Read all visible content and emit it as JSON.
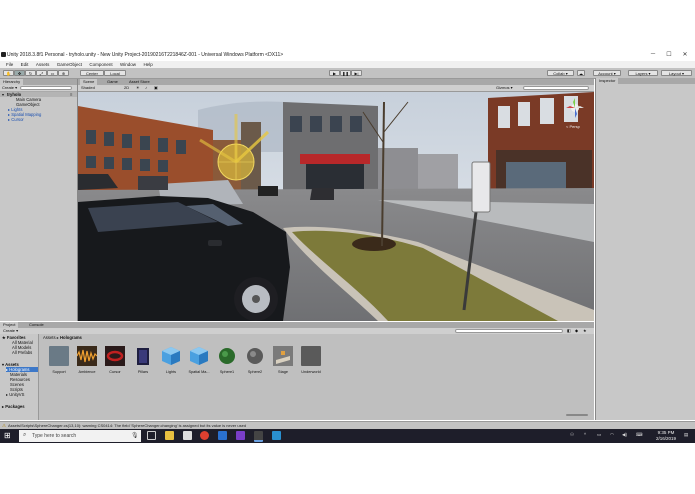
{
  "window": {
    "title": "Unity 2018.3.8f1 Personal - tryholo.unity - New Unity Project-20190216T221846Z-001 - Universal Windows Platform <DX11>",
    "controls": [
      "─",
      "☐",
      "✕"
    ]
  },
  "menu": [
    "File",
    "Edit",
    "Assets",
    "GameObject",
    "Component",
    "Window",
    "Help"
  ],
  "toolbar": {
    "pivot_label": "Center",
    "space_label": "Local",
    "collab_label": "Collab ▾",
    "account_label": "Account ▾",
    "layers_label": "Layers ▾",
    "layout_label": "Layout ▾"
  },
  "hierarchy": {
    "tab": "Hierarchy",
    "create_label": "Create ▾",
    "scene_name": "tryholo",
    "items": [
      "Main Camera",
      "GameObject",
      "Lights",
      "Spatial Mapping",
      "Cursor"
    ]
  },
  "scene_view": {
    "tabs": [
      "Scene",
      "Game",
      "Asset Store"
    ],
    "shading": "Shaded",
    "mode_2d": "2D",
    "gizmos": "Gizmos ▾",
    "persp": "< Persp"
  },
  "project": {
    "tabs": [
      "Project",
      "Console"
    ],
    "create_label": "Create ▾",
    "breadcrumb": [
      "Assets",
      "Holograms"
    ],
    "favorites_title": "Favorites",
    "favorites": [
      "All Material",
      "All Models",
      "All Prefabs"
    ],
    "assets_title": "Assets",
    "folders": [
      "Holograms",
      "Materials",
      "Resources",
      "Scenes",
      "Scripts",
      "UnityVS"
    ],
    "packages_title": "Packages",
    "assets": [
      {
        "label": "Support",
        "color": "#6a7a86"
      },
      {
        "label": "Ambience",
        "color": "#d07a20"
      },
      {
        "label": "Cursor",
        "color": "#8a1a1a"
      },
      {
        "label": "Pillars",
        "color": "#2a2a5a"
      },
      {
        "label": "Lights",
        "color": "#4aa0e0"
      },
      {
        "label": "Spatial Ma...",
        "color": "#4aa0e0"
      },
      {
        "label": "Sphere1",
        "color": "#2a6a2a"
      },
      {
        "label": "Sphere2",
        "color": "#6a6a6a"
      },
      {
        "label": "Stage",
        "color": "#7a7a7a"
      },
      {
        "label": "Underworld",
        "color": "#5a5a5a"
      }
    ]
  },
  "inspector": {
    "tab": "Inspector"
  },
  "status": {
    "message": "Assets\\Scripts\\SphereChanger.cs(13,10): warning CS0414: The field 'SphereChanger.changing' is assigned but its value is never used"
  },
  "taskbar": {
    "search_placeholder": "Type here to search",
    "time": "9:35 PM",
    "date": "2/16/2019"
  },
  "colors": {
    "editor_gray": "#c8c8c8",
    "taskbar": "#1e1e2a",
    "selection": "#3d78c8"
  }
}
